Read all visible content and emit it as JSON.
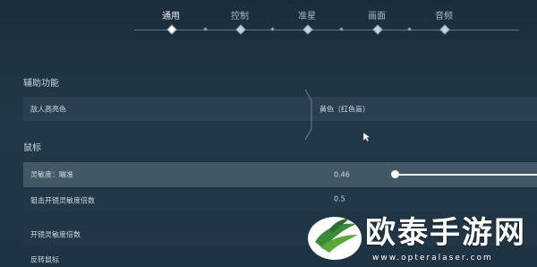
{
  "tabs": [
    {
      "label": "通用",
      "active": true
    },
    {
      "label": "控制",
      "active": false
    },
    {
      "label": "准星",
      "active": false
    },
    {
      "label": "画面",
      "active": false
    },
    {
      "label": "音频",
      "active": false
    }
  ],
  "sections": {
    "accessibility": "辅助功能",
    "mouse": "鼠标"
  },
  "rows": {
    "enemy_highlight": {
      "label": "敌人高亮色",
      "value": "黄色（红色盲）"
    },
    "sensitivity_aim": {
      "label": "灵敏度：瞄准",
      "value": "0.46",
      "fraction": 0.46
    },
    "scoped_sensitivity": {
      "label": "狙击开镜灵敏度倍数",
      "value": "0.5"
    },
    "scope_sensitivity": {
      "label": "开镜灵敏度倍数"
    },
    "invert_mouse": {
      "label": "反转鼠标"
    }
  },
  "watermark": {
    "text": "欧泰手游网",
    "url": "www.opteralaser.com"
  },
  "colors": {
    "background": "#213848",
    "highlight_row": "#96a8b4",
    "watermark": "#ffffff",
    "logo_green": "#3a8a3a"
  }
}
